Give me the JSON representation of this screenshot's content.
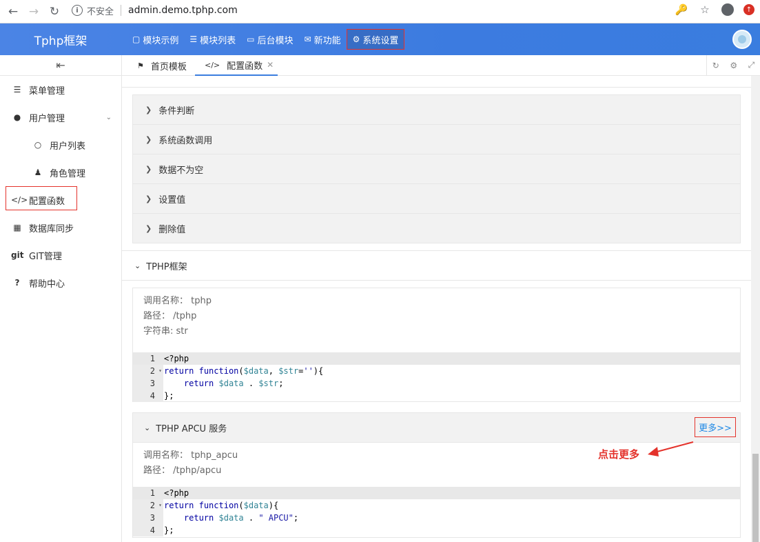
{
  "browser": {
    "insecure_label": "不安全",
    "url": "admin.demo.tphp.com"
  },
  "header": {
    "brand": "Tphp框架",
    "nav": [
      {
        "label": "模块示例",
        "icon": "monitor-icon"
      },
      {
        "label": "模块列表",
        "icon": "list-icon"
      },
      {
        "label": "后台模块",
        "icon": "laptop-icon"
      },
      {
        "label": "新功能",
        "icon": "mail-open-icon"
      },
      {
        "label": "系统设置",
        "icon": "gear-icon",
        "active": true
      }
    ]
  },
  "sidebar": {
    "items": [
      {
        "label": "菜单管理",
        "icon": "menu-icon"
      },
      {
        "label": "用户管理",
        "icon": "user-icon"
      },
      {
        "label": "用户列表",
        "icon": "user-outline-icon"
      },
      {
        "label": "角色管理",
        "icon": "person-icon"
      },
      {
        "label": "配置函数",
        "icon": "code-icon"
      },
      {
        "label": "数据库同步",
        "icon": "table-icon"
      },
      {
        "label": "GIT管理",
        "icon": "git-icon"
      },
      {
        "label": "帮助中心",
        "icon": "question-icon"
      }
    ]
  },
  "tabs": [
    {
      "label": "首页模板",
      "icon": "flag-icon"
    },
    {
      "label": "配置函数",
      "icon": "code-icon",
      "active": true
    }
  ],
  "functions_panel": {
    "rows": [
      "条件判断",
      "系统函数调用",
      "数据不为空",
      "设置值",
      "删除值"
    ]
  },
  "section": {
    "title": "TPHP框架"
  },
  "card1": {
    "call_name_label": "调用名称：",
    "call_name": "tphp",
    "path_label": "路径：",
    "path": "/tphp",
    "string_label": "字符串:",
    "string": "str",
    "code": [
      "<?php",
      "return function($data, $str=''){",
      "    return $data . $str;",
      "};"
    ]
  },
  "card2": {
    "title": "TPHP APCU 服务",
    "more": "更多>>",
    "call_name_label": "调用名称：",
    "call_name": "tphp_apcu",
    "path_label": "路径：",
    "path": "/tphp/apcu",
    "code": [
      "<?php",
      "return function($data){",
      "    return $data . \" APCU\";",
      "};"
    ]
  },
  "annotation": "点击更多",
  "colors": {
    "accent": "#3a7ddf",
    "highlight": "#e4322b",
    "link": "#1e88e5"
  }
}
